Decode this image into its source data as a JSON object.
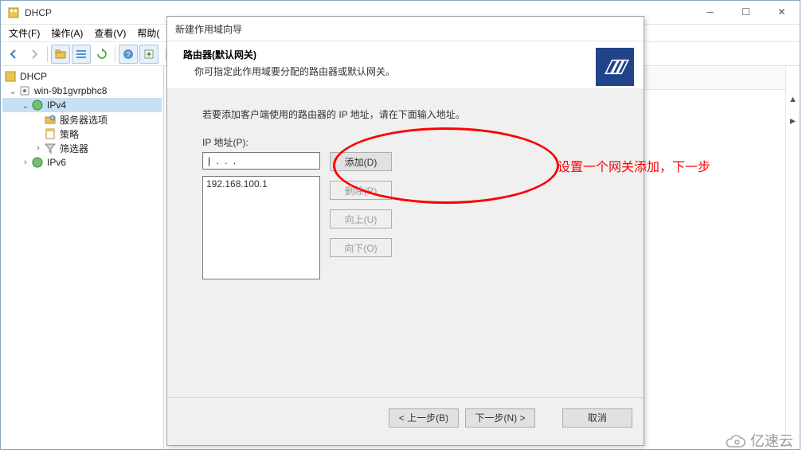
{
  "app": {
    "title": "DHCP",
    "menu": {
      "file": "文件(F)",
      "action": "操作(A)",
      "view": "查看(V)",
      "help": "帮助("
    }
  },
  "tree": {
    "root": "DHCP",
    "server": "win-9b1gvrpbhc8",
    "ipv4": "IPv4",
    "node_options": "服务器选项",
    "node_policy": "策略",
    "node_filter": "筛选器",
    "ipv6": "IPv6"
  },
  "wizard": {
    "title": "新建作用域向导",
    "heading": "路由器(默认网关)",
    "sub": "你可指定此作用域要分配的路由器或默认网关。",
    "instr": "若要添加客户端使用的路由器的 IP 地址，请在下面输入地址。",
    "ip_label": "IP 地址(P):",
    "ip_entry": "|    .      .      .",
    "btn_add": "添加(D)",
    "btn_remove": "删除(R)",
    "btn_up": "向上(U)",
    "btn_down": "向下(O)",
    "ip_list": [
      "192.168.100.1"
    ],
    "btn_back": "< 上一步(B)",
    "btn_next": "下一步(N) >",
    "btn_cancel": "取消"
  },
  "annot": {
    "text": "设置一个网关添加，下一步"
  },
  "watermark": {
    "text": "亿速云"
  }
}
